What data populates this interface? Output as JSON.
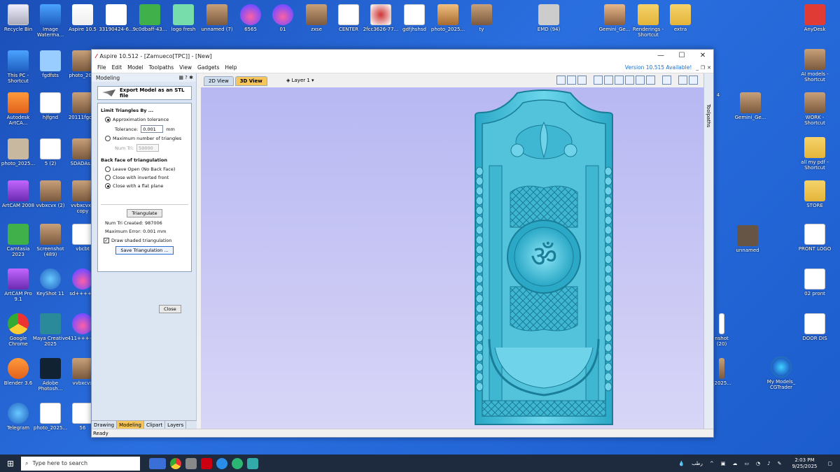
{
  "desktop": {
    "left_icons": [
      "Recycle Bin",
      "Image Waterma...",
      "Aspire 10.5",
      "33190424-6...",
      "9c0dbaff-43...",
      "logo fresh",
      "unnamed (7)",
      "6565",
      "01",
      "zxse",
      "CENTER",
      "2fcc3626-77...",
      "gdfjhshsd",
      "photo_2025...",
      "ty",
      "EMD (94)",
      "Gemini_Ge...",
      "Renderings - Shortcut",
      "extra",
      "AnyDesk"
    ],
    "col1": [
      "This PC - Shortcut",
      "Autodesk ArtCA...",
      "photo_2025...",
      "ArtCAM 2008",
      "Camtasia 2023",
      "ArtCAM Pro 9.1",
      "Google Chrome",
      "Blender 3.6",
      "Telegram"
    ],
    "col2": [
      "fgdfsts",
      "hjfgnd",
      "5 (2)",
      "vvbxcvx (2)",
      "Screenshot (489)",
      "KeyShot 11",
      "Maya Creative 2025",
      "Adobe Photosh...",
      "photo_2025..."
    ],
    "col3": [
      "photo_20...",
      "20111fgd...",
      "SDADAs...",
      "vvbxcvx - copy",
      "vbcbt",
      "sd+++++",
      "411+++++",
      "vvbxcvx",
      "56"
    ],
    "right_icons": [
      "AI models - Shortcut",
      "WORK - Shortcut",
      "all my pdf - Shortcut",
      "STORE",
      "PRONT LOGO",
      "02 pront",
      "DOOR DIS",
      "My Models_ CGTrader"
    ],
    "mid_icons": [
      "4",
      "Gemini_Ge...",
      "unnamed",
      "nshot (20)",
      "_2025..."
    ]
  },
  "window": {
    "title": "Aspire 10.512 - [Zamueco[TPC]] - [New]",
    "menu": [
      "File",
      "Edit",
      "Model",
      "Toolpaths",
      "View",
      "Gadgets",
      "Help"
    ],
    "version_notice": "Version 10.515 Available!",
    "panel_title": "Modeling",
    "export_label": "Export Model as an STL file",
    "limit_section": "Limit Triangles By ...",
    "opt_tolerance": "Approximation tolerance",
    "tolerance_label": "Tolerance:",
    "tolerance_value": "0.001",
    "tolerance_unit": "mm",
    "opt_max_tri": "Maximum number of triangles",
    "numtri_label": "Num Tri:",
    "numtri_value": "50000",
    "backface_section": "Back face of triangulation",
    "opt_open": "Leave Open (No Back Face)",
    "opt_inverted": "Close with inverted front",
    "opt_flat": "Close with a flat plane",
    "triangulate_btn": "Triangulate",
    "num_created_label": "Num Tri Created:",
    "num_created_value": "987006",
    "max_error_label": "Maximum Error:",
    "max_error_value": "0.001 mm",
    "draw_shaded": "Draw shaded triangulation",
    "save_btn": "Save Triangulation ...",
    "close_btn": "Close",
    "bottom_tabs": [
      "Drawing",
      "Modeling",
      "Clipart",
      "Layers"
    ],
    "view_tabs": [
      "2D View",
      "3D View"
    ],
    "layer_label": "Layer 1",
    "side_tab": "Toolpaths",
    "status": "Ready"
  },
  "taskbar": {
    "search_placeholder": "Type here to search",
    "weather": "رطب",
    "time": "2:03 PM",
    "date": "9/25/2025"
  },
  "colors": {
    "model": "#4ec5de",
    "model_dark": "#1e7f98",
    "viewport_top": "#b7b8f3",
    "accent_tab": "#f7c65a"
  }
}
